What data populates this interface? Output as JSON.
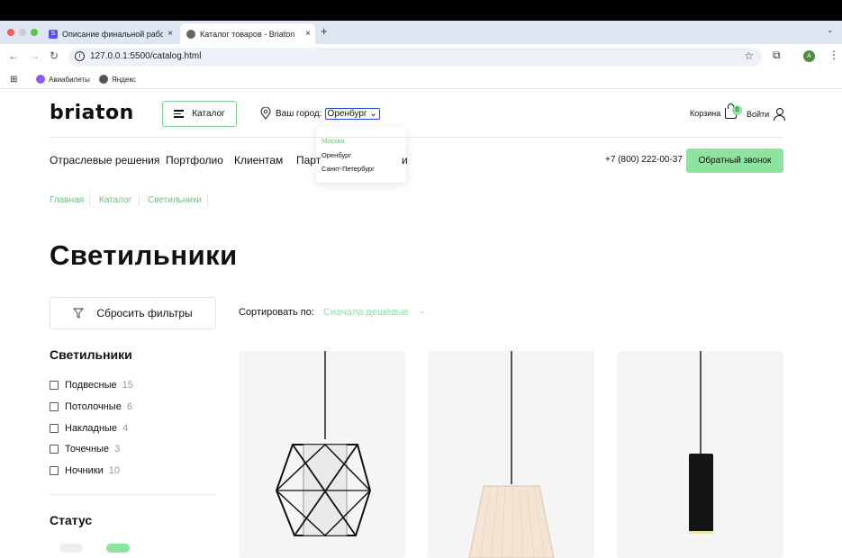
{
  "browser": {
    "tabs": [
      {
        "title": "Описание финальной работы",
        "close": "×"
      },
      {
        "title": "Каталог товаров - Briaton",
        "close": "×"
      }
    ],
    "new_tab": "+",
    "url": "127.0.0.1:5500/catalog.html",
    "profile_initial": "A",
    "bookmarks": [
      {
        "label": "Авиабилеты"
      },
      {
        "label": "Яндекс"
      }
    ]
  },
  "header": {
    "logo": "briaton",
    "catalog_button": "Каталог",
    "city_label": "Ваш город:",
    "city_selected": "Оренбург",
    "city_options": [
      "Москва",
      "Оренбург",
      "Санкт-Петербург"
    ],
    "cart_label": "Корзина",
    "cart_count": "0",
    "login_label": "Войти"
  },
  "nav": {
    "items": [
      "Отраслевые решения",
      "Портфолио",
      "Клиентам",
      "Парт",
      "и"
    ],
    "phone": "+7 (800) 222-00-37",
    "callback_button": "Обратный звонок"
  },
  "breadcrumbs": [
    "Главная",
    "Каталог",
    "Светильники"
  ],
  "page_title": "Светильники",
  "filters": {
    "reset_button": "Сбросить фильтры",
    "section_title": "Светильники",
    "items": [
      {
        "label": "Подвесные",
        "count": "15"
      },
      {
        "label": "Потолочные",
        "count": "6"
      },
      {
        "label": "Накладные",
        "count": "4"
      },
      {
        "label": "Точечные",
        "count": "3"
      },
      {
        "label": "Ночники",
        "count": "10"
      }
    ],
    "status_title": "Статус"
  },
  "sort": {
    "label": "Сортировать по:",
    "value": "Сначала дешёвые"
  },
  "colors": {
    "accent": "#8ee39f",
    "accent_text": "#6cc47f",
    "select_outline": "#1a4fd1"
  }
}
